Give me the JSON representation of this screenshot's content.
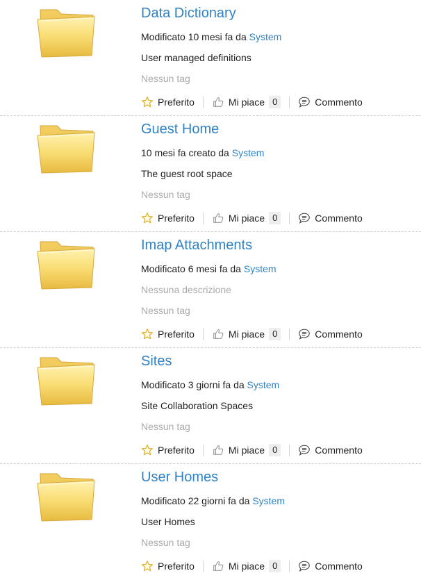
{
  "items": [
    {
      "name": "Data Dictionary",
      "modified_prefix": "Modificato 10 mesi fa da ",
      "modified_user": "System",
      "description": "User managed definitions",
      "description_empty": false,
      "tags": "Nessun tag",
      "favourite_label": "Preferito",
      "like_label": "Mi piace",
      "like_count": "0",
      "comment_label": "Commento"
    },
    {
      "name": "Guest Home",
      "modified_prefix": "10 mesi fa creato da ",
      "modified_user": "System",
      "description": "The guest root space",
      "description_empty": false,
      "tags": "Nessun tag",
      "favourite_label": "Preferito",
      "like_label": "Mi piace",
      "like_count": "0",
      "comment_label": "Commento"
    },
    {
      "name": "Imap Attachments",
      "modified_prefix": "Modificato 6 mesi fa da ",
      "modified_user": "System",
      "description": "Nessuna descrizione",
      "description_empty": true,
      "tags": "Nessun tag",
      "favourite_label": "Preferito",
      "like_label": "Mi piace",
      "like_count": "0",
      "comment_label": "Commento"
    },
    {
      "name": "Sites",
      "modified_prefix": "Modificato 3 giorni fa da ",
      "modified_user": "System",
      "description": "Site Collaboration Spaces",
      "description_empty": false,
      "tags": "Nessun tag",
      "favourite_label": "Preferito",
      "like_label": "Mi piace",
      "like_count": "0",
      "comment_label": "Commento"
    },
    {
      "name": "User Homes",
      "modified_prefix": "Modificato 22 giorni fa da ",
      "modified_user": "System",
      "description": "User Homes",
      "description_empty": false,
      "tags": "Nessun tag",
      "favourite_label": "Preferito",
      "like_label": "Mi piace",
      "like_count": "0",
      "comment_label": "Commento"
    }
  ],
  "colors": {
    "link": "#2f82c5",
    "muted": "#aaaaaa",
    "folder": "#f7d25e"
  },
  "icons": {
    "thumbnail": "folder-icon",
    "favourite": "star-icon",
    "like": "thumbs-up-icon",
    "comment": "speech-bubble-icon"
  }
}
